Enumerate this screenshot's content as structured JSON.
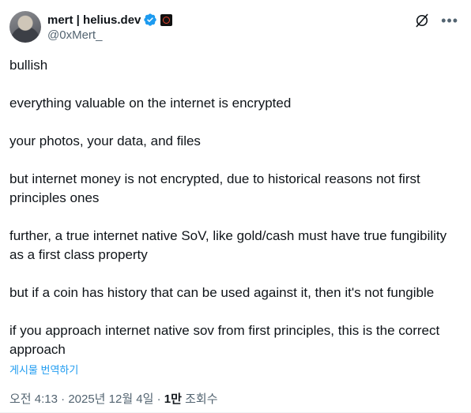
{
  "author": {
    "display_name": "mert | helius.dev",
    "handle": "@0xMert_"
  },
  "tweet": {
    "paragraphs": [
      "bullish",
      "everything valuable on the internet is encrypted",
      "your photos, your data, and files",
      "but internet money is not encrypted, due to historical reasons not first principles ones",
      "further, a true internet native SoV, like gold/cash must have true fungibility as a first class property",
      "but if a coin has history that can be used against it, then it's not fungible",
      "if you approach internet native sov from first principles, this is the correct approach"
    ],
    "translate_label": "게시물 번역하기"
  },
  "meta": {
    "time": "오전 4:13",
    "separator": "·",
    "date": "2025년 12월 4일",
    "views_count": "1만",
    "views_label": "조회수"
  },
  "icons": {
    "verified": "verified-badge-icon",
    "affiliation": "affiliation-badge-icon",
    "grok": "grok-icon",
    "more": "more-icon"
  },
  "colors": {
    "verified_blue": "#1d9bf0",
    "secondary_text": "#536471",
    "primary_text": "#0f1419",
    "link": "#1d9bf0"
  }
}
